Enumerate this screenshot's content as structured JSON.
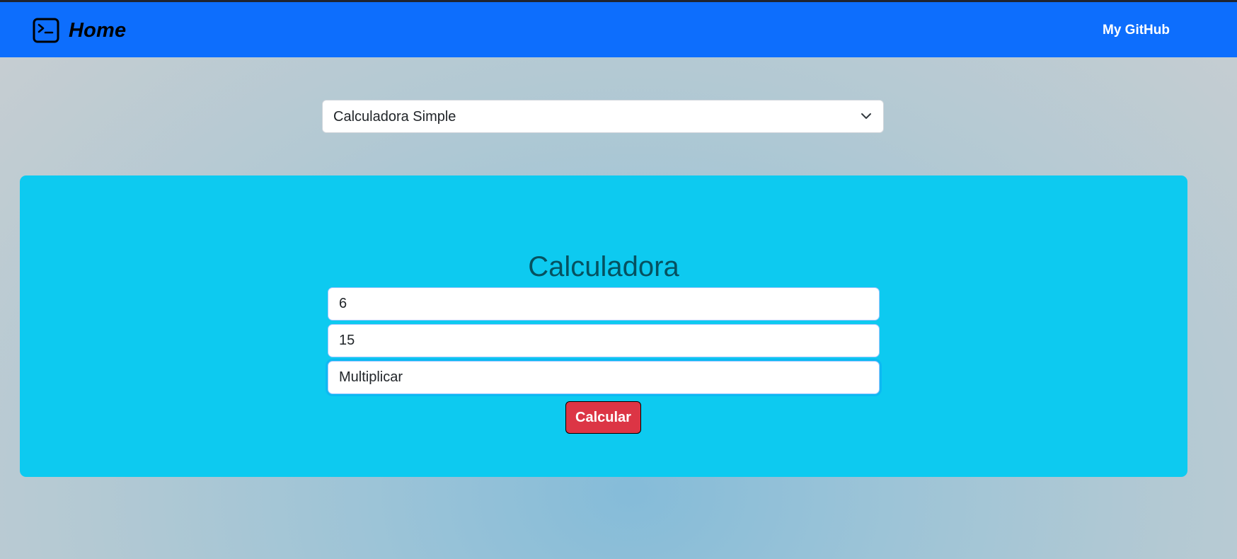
{
  "navbar": {
    "brand_label": "Home",
    "brand_icon": "terminal-icon",
    "link_label": "My GitHub",
    "background_color": "#0d6efd"
  },
  "calculator_select": {
    "selected_value": "Calculadora Simple",
    "icon": "chevron-down-icon"
  },
  "calculator_card": {
    "title": "Calculadora",
    "background_color": "#0dcaf0",
    "first_number": "6",
    "second_number": "15",
    "operation": "Multiplicar",
    "submit_label": "Calcular",
    "submit_color": "#dc3545"
  }
}
